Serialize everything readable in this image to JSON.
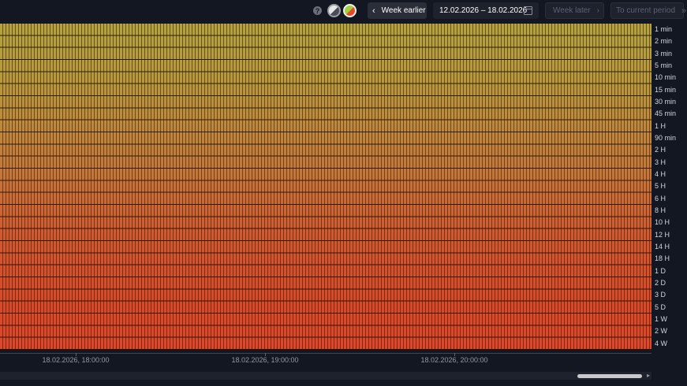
{
  "toolbar": {
    "help_icon": "?",
    "theme_mono_icon": "contrast-icon",
    "theme_color_icon": "color-theme-icon",
    "prev_chevron": "‹",
    "prev_label": "Week earlier",
    "date_range": "12.02.2026 – 18.02.2026",
    "calendar_icon": "calendar-icon",
    "next_label": "Week later",
    "next_chevron": "›",
    "current_label": "To current period",
    "current_chevron": "»"
  },
  "heatmap": {
    "color_top": "#b3a33f",
    "color_bottom": "#e0472a",
    "y_labels": [
      "1 min",
      "2 min",
      "3 min",
      "5 min",
      "10 min",
      "15 min",
      "30 min",
      "45 min",
      "1 H",
      "90 min",
      "2 H",
      "3 H",
      "4 H",
      "5 H",
      "6 H",
      "8 H",
      "10 H",
      "12 H",
      "14 H",
      "18 H",
      "1 D",
      "2 D",
      "3 D",
      "5 D",
      "1 W",
      "2 W",
      "4 W"
    ],
    "x_labels": [
      "18.02.2026, 18:00:00",
      "18.02.2026, 19:00:00",
      "18.02.2026, 20:00:00"
    ]
  },
  "scrollbar": {
    "arrow": "▸"
  }
}
